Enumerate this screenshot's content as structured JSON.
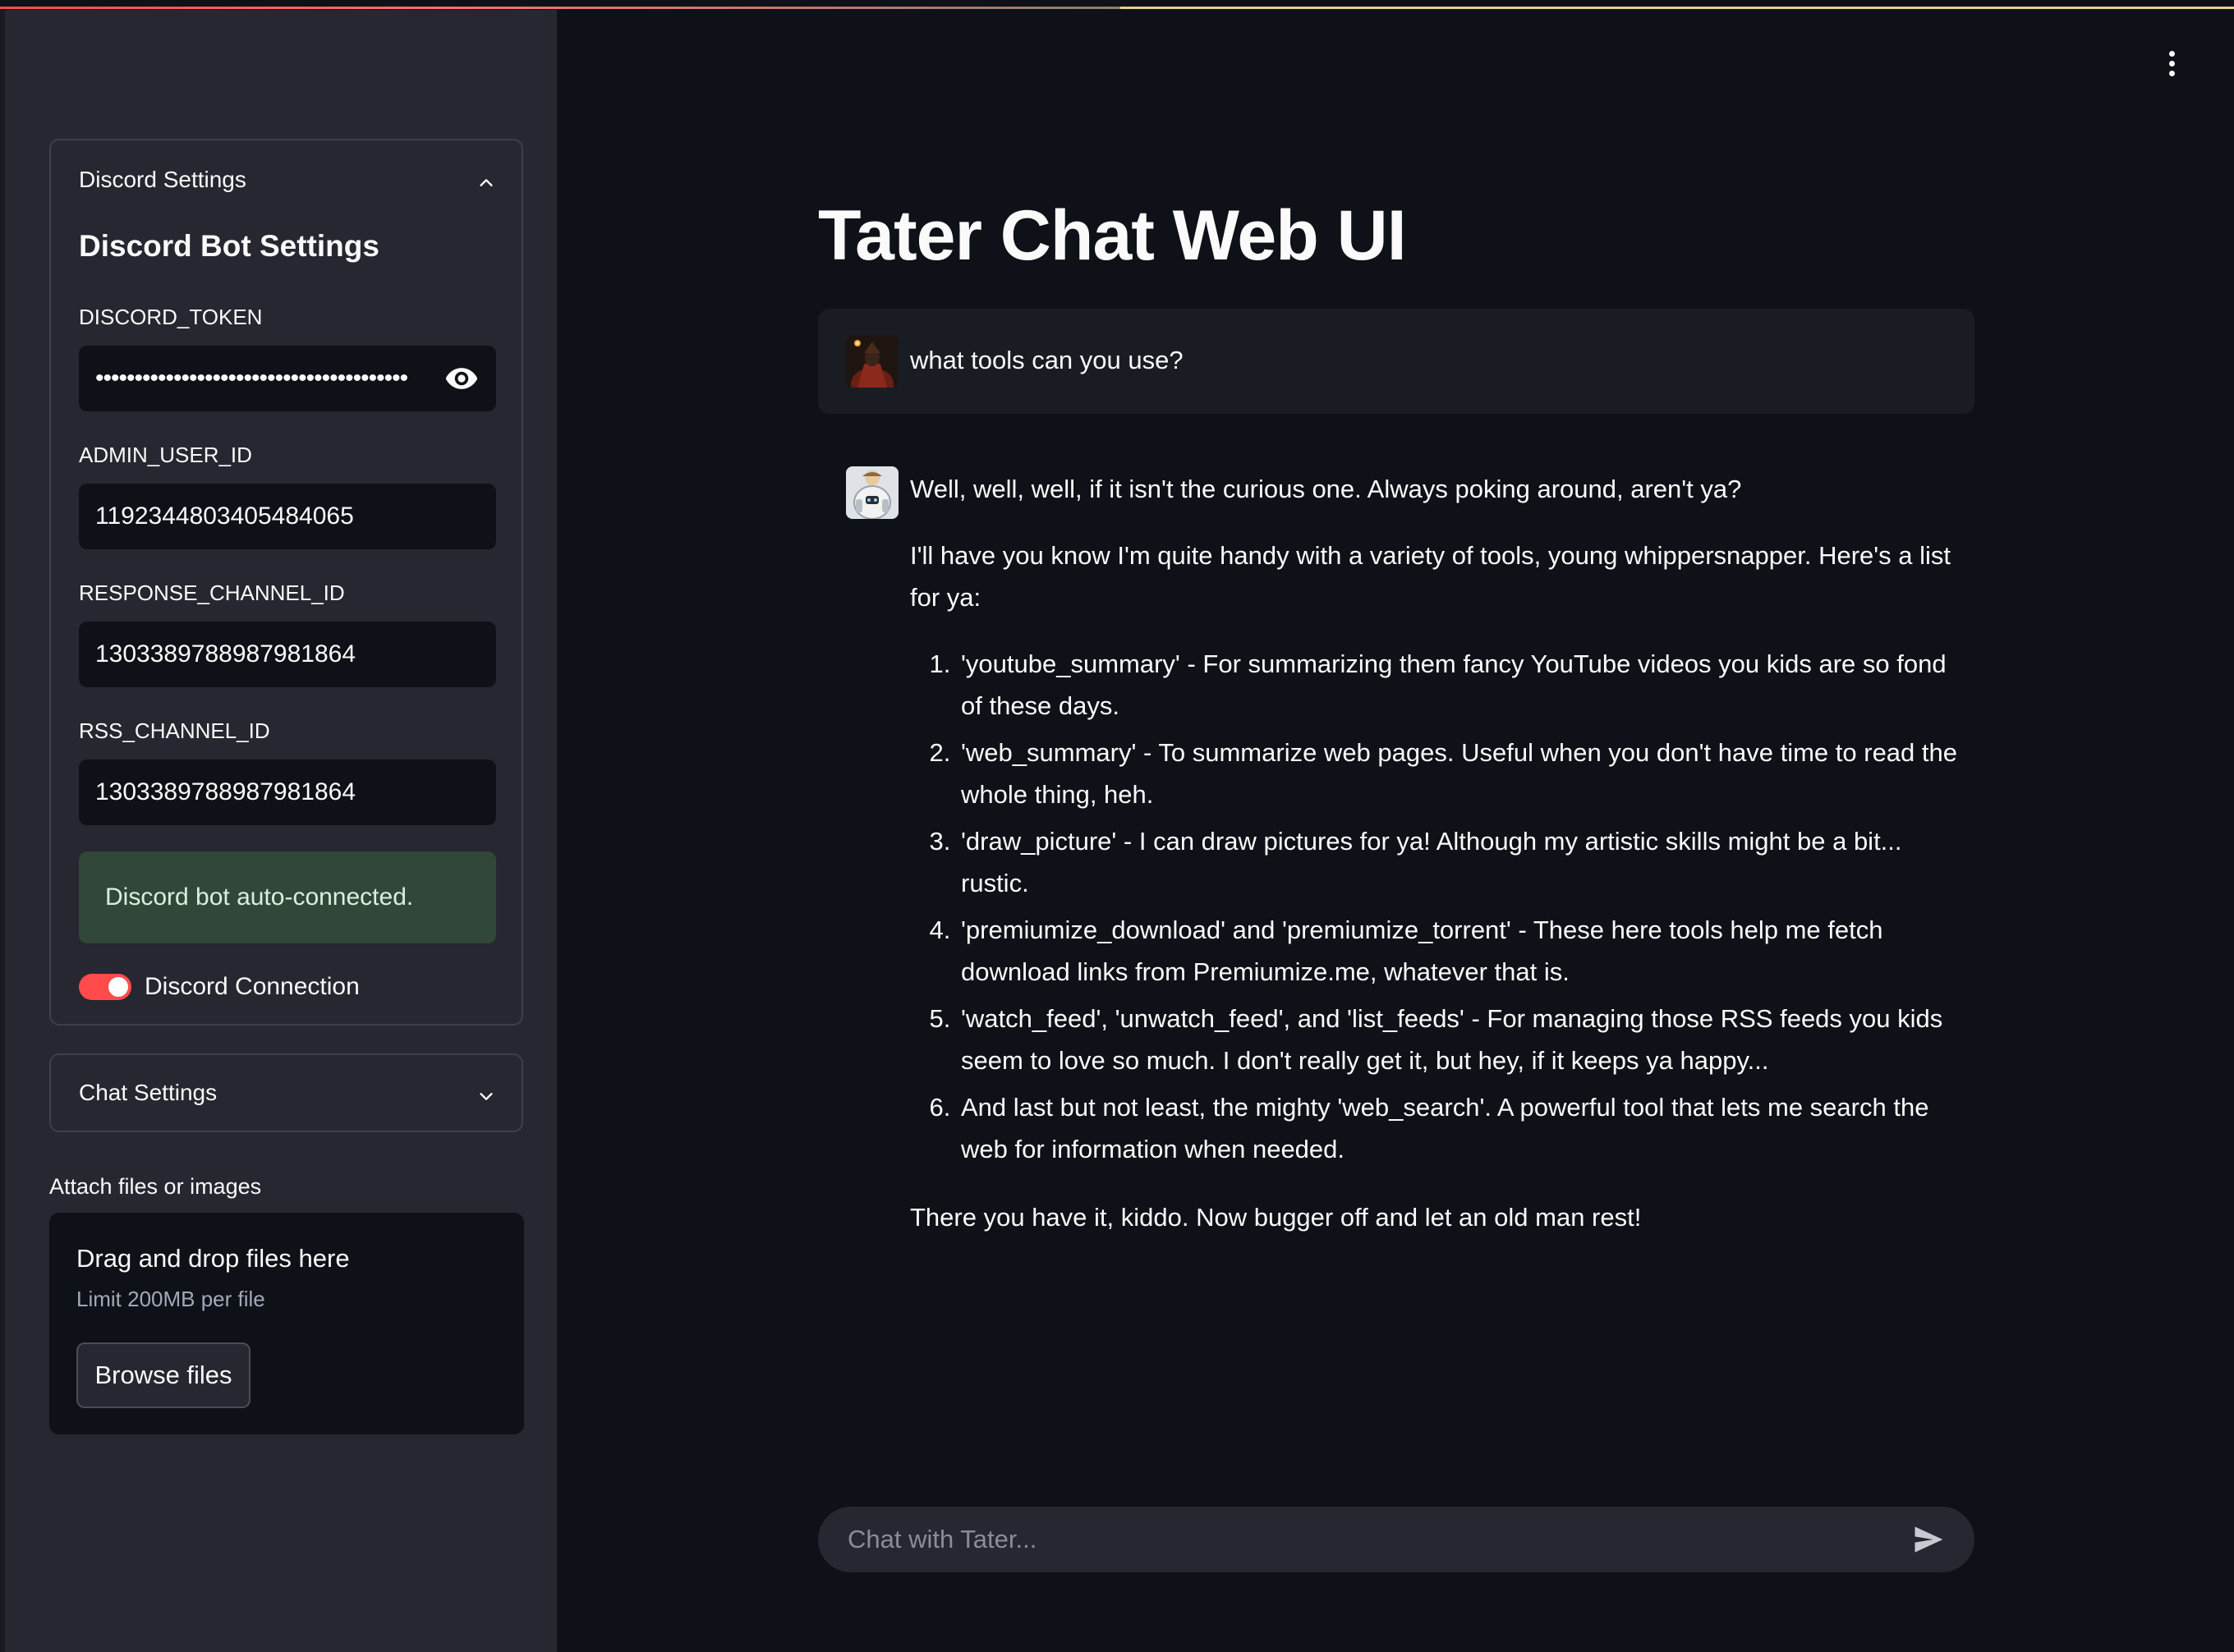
{
  "app": {
    "title": "Tater Chat Web UI",
    "menu_icon": "more-vert-icon"
  },
  "sidebar": {
    "discord_settings": {
      "header": "Discord Settings",
      "expanded": true,
      "subheading": "Discord Bot Settings",
      "fields": {
        "discord_token": {
          "label": "DISCORD_TOKEN",
          "value": "••••••••••••••••••••••••••••••••••••••••"
        },
        "admin_user_id": {
          "label": "ADMIN_USER_ID",
          "value": "1192344803405484065"
        },
        "response_channel_id": {
          "label": "RESPONSE_CHANNEL_ID",
          "value": "1303389788987981864"
        },
        "rss_channel_id": {
          "label": "RSS_CHANNEL_ID",
          "value": "1303389788987981864"
        }
      },
      "alert": "Discord bot auto-connected.",
      "toggle_label": "Discord Connection",
      "toggle_on": true
    },
    "chat_settings": {
      "header": "Chat Settings",
      "expanded": false
    },
    "attach": {
      "label": "Attach files or images",
      "drop_title": "Drag and drop files here",
      "drop_limit": "Limit 200MB per file",
      "browse_label": "Browse files"
    }
  },
  "chat": {
    "user_message": "what tools can you use?",
    "bot_message": {
      "intro": "Well, well, well, if it isn't the curious one. Always poking around, aren't ya?",
      "lead": "I'll have you know I'm quite handy with a variety of tools, young whippersnapper. Here's a list for ya:",
      "items": [
        "'youtube_summary' - For summarizing them fancy YouTube videos you kids are so fond of these days.",
        "'web_summary' - To summarize web pages. Useful when you don't have time to read the whole thing, heh.",
        "'draw_picture' - I can draw pictures for ya! Although my artistic skills might be a bit... rustic.",
        "'premiumize_download' and 'premiumize_torrent' - These here tools help me fetch download links from Premiumize.me, whatever that is.",
        "'watch_feed', 'unwatch_feed', and 'list_feeds' - For managing those RSS feeds you kids seem to love so much. I don't really get it, but hey, if it keeps ya happy...",
        "And last but not least, the mighty 'web_search'. A powerful tool that lets me search the web for information when needed."
      ],
      "outro": "There you have it, kiddo. Now bugger off and let an old man rest!"
    },
    "input_placeholder": "Chat with Tater..."
  },
  "colors": {
    "background": "#0e1117",
    "sidebar": "#262730",
    "accent": "#ff4b4b",
    "success_bg": "#30473a"
  }
}
